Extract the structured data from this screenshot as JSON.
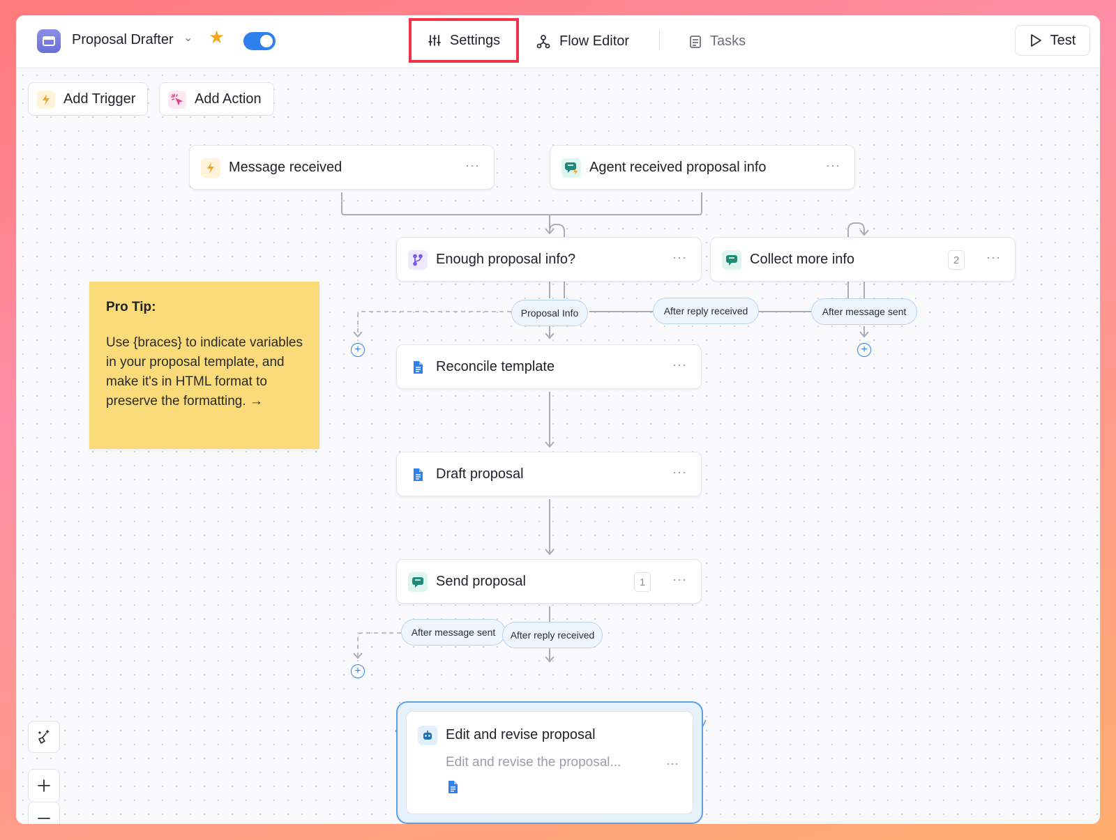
{
  "header": {
    "app_title": "Proposal Drafter",
    "tabs": [
      {
        "label": "Settings"
      },
      {
        "label": "Flow Editor"
      },
      {
        "label": "Tasks"
      }
    ],
    "test_label": "Test"
  },
  "toolbar": {
    "add_trigger": "Add Trigger",
    "add_action": "Add Action"
  },
  "nodes": {
    "message_received": "Message received",
    "agent_received": "Agent received proposal info",
    "enough_info": "Enough proposal info?",
    "collect_more": "Collect more info",
    "collect_more_count": "2",
    "reconcile": "Reconcile template",
    "draft": "Draft proposal",
    "send": "Send proposal",
    "send_count": "1",
    "edit_revise_title": "Edit and revise proposal",
    "edit_revise_sub": "Edit and revise the proposal..."
  },
  "pills": {
    "proposal_info": "Proposal Info",
    "after_reply_1": "After reply received",
    "after_message_1": "After message sent",
    "after_message_2": "After message sent",
    "after_reply_2": "After reply received"
  },
  "tip": {
    "title": "Pro Tip:",
    "body": "Use {braces} to indicate variables in your proposal template, and make it's in HTML format to preserve the formatting. →"
  },
  "colors": {
    "accent": "#2f80ed",
    "highlight": "#f0334b",
    "tip_bg": "#fadb7a"
  }
}
